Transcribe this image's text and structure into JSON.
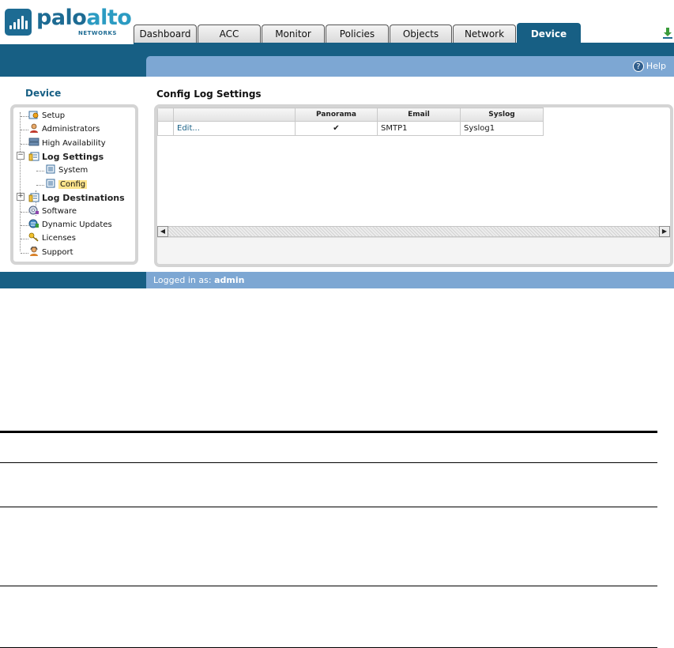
{
  "brand": {
    "logo_main": "palo",
    "logo_accent": "alto",
    "logo_subtitle": "NETWORKS"
  },
  "nav_tabs": [
    {
      "label": "Dashboard",
      "active": false
    },
    {
      "label": "ACC",
      "active": false
    },
    {
      "label": "Monitor",
      "active": false
    },
    {
      "label": "Policies",
      "active": false
    },
    {
      "label": "Objects",
      "active": false
    },
    {
      "label": "Network",
      "active": false
    },
    {
      "label": "Device",
      "active": true
    }
  ],
  "icons": {
    "download": "download-icon",
    "help": "help-icon"
  },
  "help": {
    "icon_glyph": "?",
    "label": "Help"
  },
  "sidebar": {
    "title": "Device",
    "items": [
      {
        "label": "Setup",
        "icon": "setup-icon"
      },
      {
        "label": "Administrators",
        "icon": "administrators-icon"
      },
      {
        "label": "High Availability",
        "icon": "high-availability-icon"
      },
      {
        "label": "Log Settings",
        "icon": "log-settings-icon",
        "expander": "−",
        "expanded": true
      },
      {
        "label": "System",
        "icon": "document-icon"
      },
      {
        "label": "Config",
        "icon": "document-icon",
        "selected": true
      },
      {
        "label": "Log Destinations",
        "icon": "log-destinations-icon",
        "expander": "+",
        "expanded": false
      },
      {
        "label": "Software",
        "icon": "software-icon"
      },
      {
        "label": "Dynamic Updates",
        "icon": "dynamic-updates-icon"
      },
      {
        "label": "Licenses",
        "icon": "key-icon"
      },
      {
        "label": "Support",
        "icon": "support-icon"
      }
    ]
  },
  "content": {
    "title": "Config Log Settings",
    "table": {
      "columns": [
        "",
        "",
        "Panorama",
        "Email",
        "Syslog"
      ],
      "rows": [
        {
          "action": "Edit...",
          "panorama": "✔",
          "email": "SMTP1",
          "syslog": "Syslog1"
        }
      ]
    },
    "scroll_left": "◀",
    "scroll_right": "▶"
  },
  "status": {
    "prefix": "Logged in as:",
    "user": "admin"
  },
  "colors": {
    "brand_dark": "#175f84",
    "brand_light": "#7da7d3",
    "selection": "#fde48c"
  }
}
